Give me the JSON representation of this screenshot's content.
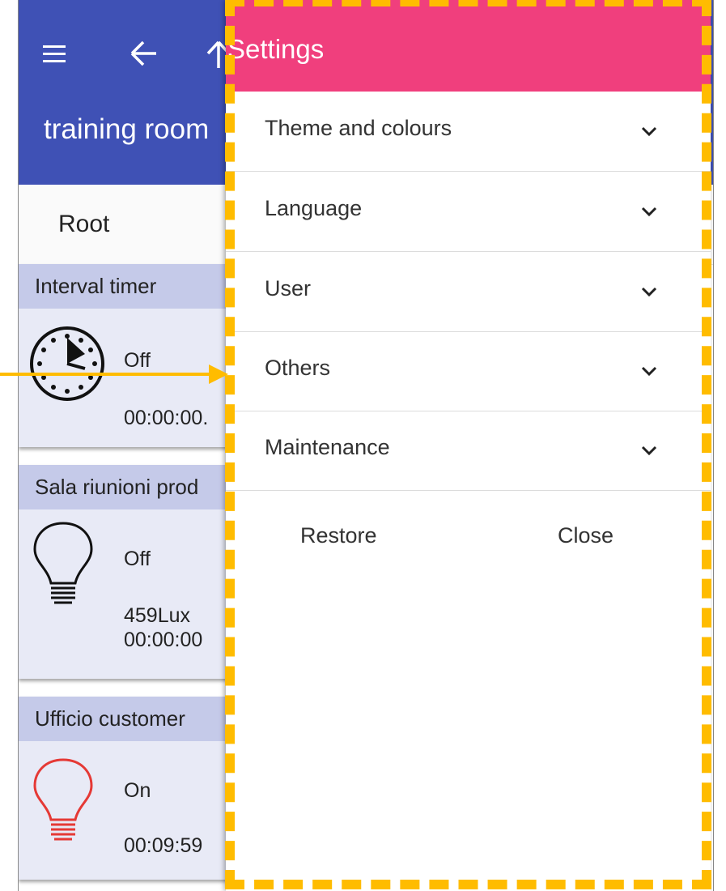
{
  "app": {
    "room_title": "training room",
    "breadcrumb_root": "Root",
    "cards": [
      {
        "title": "Interval timer",
        "state": "Off",
        "values": [
          "00:00:00."
        ]
      },
      {
        "title": "Sala riunioni prod",
        "state": "Off",
        "values": [
          "459Lux",
          "00:00:00"
        ]
      },
      {
        "title": "Ufficio customer",
        "state": "On",
        "values": [
          "00:09:59"
        ]
      }
    ],
    "icons": [
      "menu-icon",
      "back-arrow-icon",
      "up-arrow-icon",
      "timer-icon",
      "bulb-icon",
      "bulb-icon"
    ]
  },
  "settings": {
    "title": "Settings",
    "sections": [
      {
        "label": "Theme and colours"
      },
      {
        "label": "Language"
      },
      {
        "label": "User"
      },
      {
        "label": "Others"
      },
      {
        "label": "Maintenance"
      }
    ],
    "restore_label": "Restore",
    "close_label": "Close"
  },
  "colors": {
    "appbar": "#3f51b5",
    "settings_header": "#f03f7d",
    "card_header": "#c5cae9",
    "card_body": "#e8eaf6",
    "highlight": "#ffbc00",
    "bulb_on": "#e53935"
  }
}
